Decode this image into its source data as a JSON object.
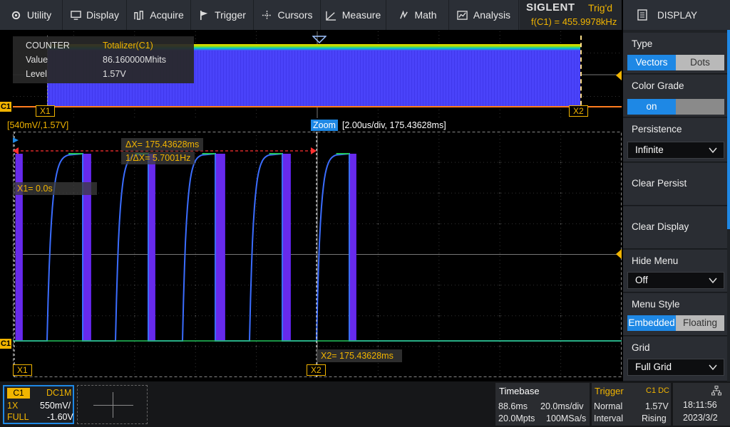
{
  "menu": [
    {
      "id": "utility",
      "label": "Utility",
      "icon": "gear-icon"
    },
    {
      "id": "display",
      "label": "Display",
      "icon": "monitor-icon"
    },
    {
      "id": "acquire",
      "label": "Acquire",
      "icon": "acquire-icon"
    },
    {
      "id": "trigger",
      "label": "Trigger",
      "icon": "flag-icon"
    },
    {
      "id": "cursors",
      "label": "Cursors",
      "icon": "crosshair-icon"
    },
    {
      "id": "measure",
      "label": "Measure",
      "icon": "measure-icon"
    },
    {
      "id": "math",
      "label": "Math",
      "icon": "math-icon"
    },
    {
      "id": "analysis",
      "label": "Analysis",
      "icon": "analysis-icon"
    }
  ],
  "brand": {
    "logo": "SIGLENT",
    "trig_status": "Trig'd",
    "frequency": "f(C1) = 455.9978kHz"
  },
  "counter": {
    "title": "COUNTER",
    "source": "Totalizer(C1)",
    "value_label": "Value",
    "value": "86.160000Mhits",
    "level_label": "Level",
    "level": "1.57V"
  },
  "overview": {
    "channel": "C1",
    "x1": "X1",
    "x2": "X2"
  },
  "zoom": {
    "scale_label": "[540mV/,1.57V]",
    "tag": "Zoom",
    "info": "[2.00us/div, 175.43628ms]"
  },
  "cursors": {
    "delta_x": "ΔX= 175.43628ms",
    "inv_delta_x": "1/ΔX= 5.7001Hz",
    "x1_value": "X1= 0.0s",
    "x2_value": "X2= 175.43628ms",
    "x1": "X1",
    "x2": "X2",
    "channel": "C1"
  },
  "panel": {
    "title": "DISPLAY",
    "type": {
      "label": "Type",
      "options": [
        "Vectors",
        "Dots"
      ],
      "selected": "Vectors"
    },
    "color_grade": {
      "label": "Color Grade",
      "value": "on"
    },
    "persistence": {
      "label": "Persistence",
      "value": "Infinite"
    },
    "clear_persist": "Clear Persist",
    "clear_display": "Clear Display",
    "hide_menu": {
      "label": "Hide Menu",
      "value": "Off"
    },
    "menu_style": {
      "label": "Menu Style",
      "options": [
        "Embedded",
        "Floating"
      ],
      "selected": "Embedded"
    },
    "grid": {
      "label": "Grid",
      "value": "Full Grid"
    }
  },
  "channel_box": {
    "tag": "C1",
    "coupling": "DC1M",
    "probe": "1X",
    "vdiv": "550mV/",
    "bw": "FULL",
    "offset": "-1.60V"
  },
  "timebase": {
    "label": "Timebase",
    "delay": "88.6ms",
    "tdiv": "20.0ms/div",
    "points": "20.0Mpts",
    "srate": "100MSa/s"
  },
  "trigger_box": {
    "label": "Trigger",
    "source": "C1 DC",
    "mode": "Normal",
    "level": "1.57V",
    "type": "Interval",
    "slope": "Rising"
  },
  "clock": {
    "time": "18:11:56",
    "date": "2023/3/2"
  },
  "colors": {
    "accent": "#1e88e5",
    "channel1": "#f1b400",
    "waveform": "#4d46ff",
    "trace_edge": "#22c55e"
  }
}
